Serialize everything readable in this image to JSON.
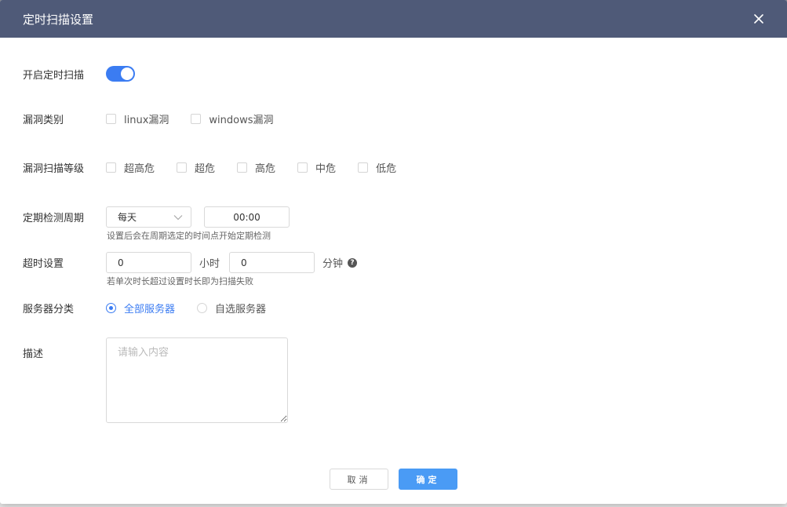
{
  "dialog": {
    "title": "定时扫描设置",
    "close_icon": "close-icon"
  },
  "scan_enabled": {
    "label": "开启定时扫描",
    "on": true
  },
  "vuln_type": {
    "label": "漏洞类别",
    "options": [
      "linux漏洞",
      "windows漏洞"
    ]
  },
  "scan_level": {
    "label": "漏洞扫描等级",
    "options": [
      "超高危",
      "超危",
      "高危",
      "中危",
      "低危"
    ]
  },
  "period": {
    "label": "定期检测周期",
    "select_value": "每天",
    "time_value": "00:00",
    "hint": "设置后会在周期选定的时间点开始定期检测"
  },
  "timeout": {
    "label": "超时设置",
    "hours_value": "0",
    "hours_unit": "小时",
    "minutes_value": "0",
    "minutes_unit": "分钟",
    "hint": "若单次时长超过设置时长即为扫描失败"
  },
  "server_scope": {
    "label": "服务器分类",
    "options": [
      "全部服务器",
      "自选服务器"
    ],
    "selected_index": 0
  },
  "description": {
    "label": "描述",
    "placeholder": "请输入内容"
  },
  "footer": {
    "cancel_label": "取消",
    "ok_label": "确定"
  },
  "colors": {
    "header_bg": "#4f5a78",
    "accent": "#3b7cf2",
    "primary_button": "#4a9bf5"
  }
}
